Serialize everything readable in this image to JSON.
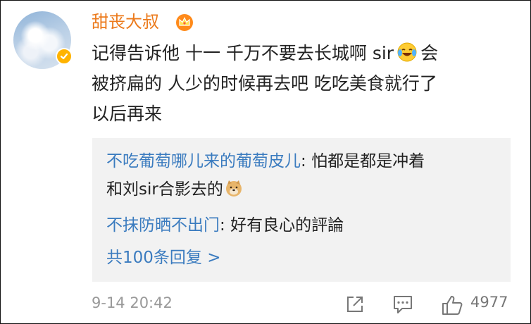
{
  "comment": {
    "username": "甜丧大叔",
    "text_line1_a": "记得告诉他 十一 千万不要去长城啊 sir",
    "text_line1_b": "会",
    "text_line2": "被挤扁的 人少的时候再去吧 吃吃美食就行了",
    "text_line3": "以后再来",
    "timestamp": "9-14 20:42",
    "like_count": "4977"
  },
  "replies": [
    {
      "name": "不吃葡萄哪儿来的葡萄皮儿",
      "text_a": "怕都是都是冲着",
      "text_b": "和刘sir合影去的"
    },
    {
      "name": "不抹防晒不出门",
      "text": "好有良心的評論"
    }
  ],
  "more_replies": "共100条回复 >",
  "separator": ": ",
  "icons": {
    "avatar": "sky-clouds-avatar",
    "verified": "verified-badge-icon",
    "crown": "crown-icon",
    "laugh": "laughing-crying-emoji",
    "doge": "doge-emoji",
    "share": "share-icon",
    "comment": "comment-icon",
    "like": "thumbs-up-icon"
  },
  "colors": {
    "username": "#ec7a1b",
    "link": "#3a7bbf",
    "muted": "#999999",
    "reply_bg": "#f2f2f2",
    "verified": "#ffb300"
  }
}
